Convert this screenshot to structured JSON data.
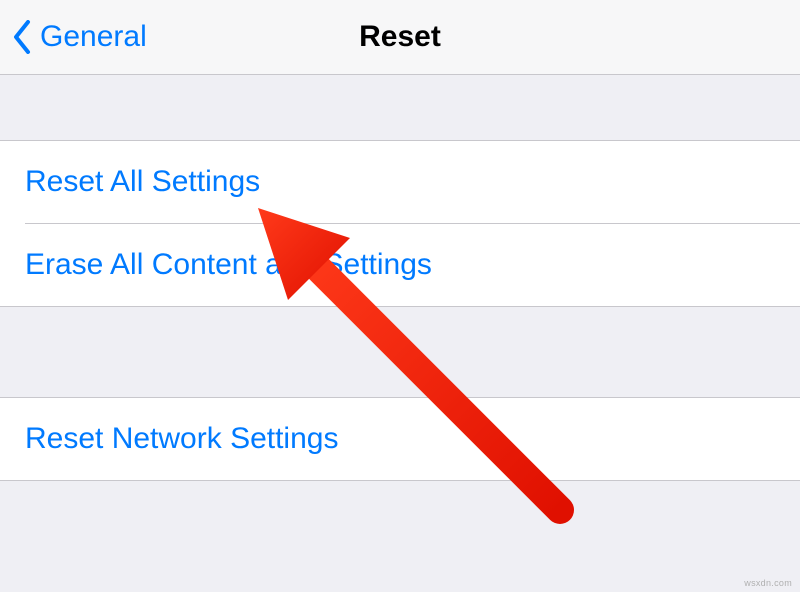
{
  "navbar": {
    "back_label": "General",
    "title": "Reset"
  },
  "groups": [
    {
      "items": [
        {
          "label": "Reset All Settings"
        },
        {
          "label": "Erase All Content and Settings"
        }
      ]
    },
    {
      "items": [
        {
          "label": "Reset Network Settings"
        }
      ]
    }
  ],
  "watermark": "wsxdn.com",
  "colors": {
    "ios_blue": "#007aff",
    "background": "#efeff4",
    "arrow_red": "#ff2a0f"
  }
}
